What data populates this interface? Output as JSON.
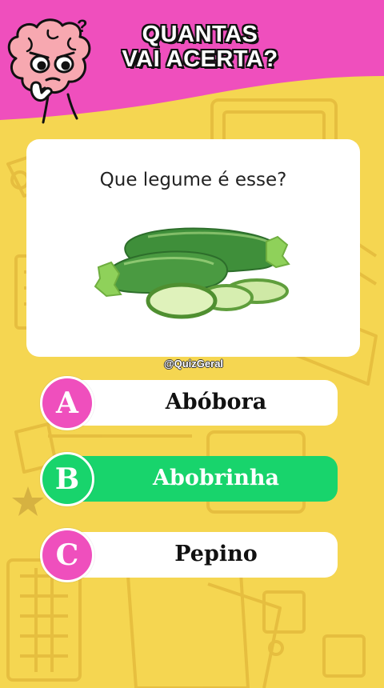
{
  "header": {
    "title_line1": "QUANTAS",
    "title_line2": "VAI ACERTA?",
    "background_color": "#ef4fbd",
    "mascot": "brain-mascot-icon"
  },
  "question": {
    "text": "Que legume é esse?",
    "image": "zucchini-image"
  },
  "watermark": "@QuizGeral",
  "options": [
    {
      "letter": "A",
      "label": "Abóbora",
      "correct": false
    },
    {
      "letter": "B",
      "label": "Abobrinha",
      "correct": true
    },
    {
      "letter": "C",
      "label": "Pepino",
      "correct": false
    }
  ],
  "colors": {
    "background": "#f5d651",
    "badge": "#ef4fbd",
    "correct": "#18d46c"
  }
}
